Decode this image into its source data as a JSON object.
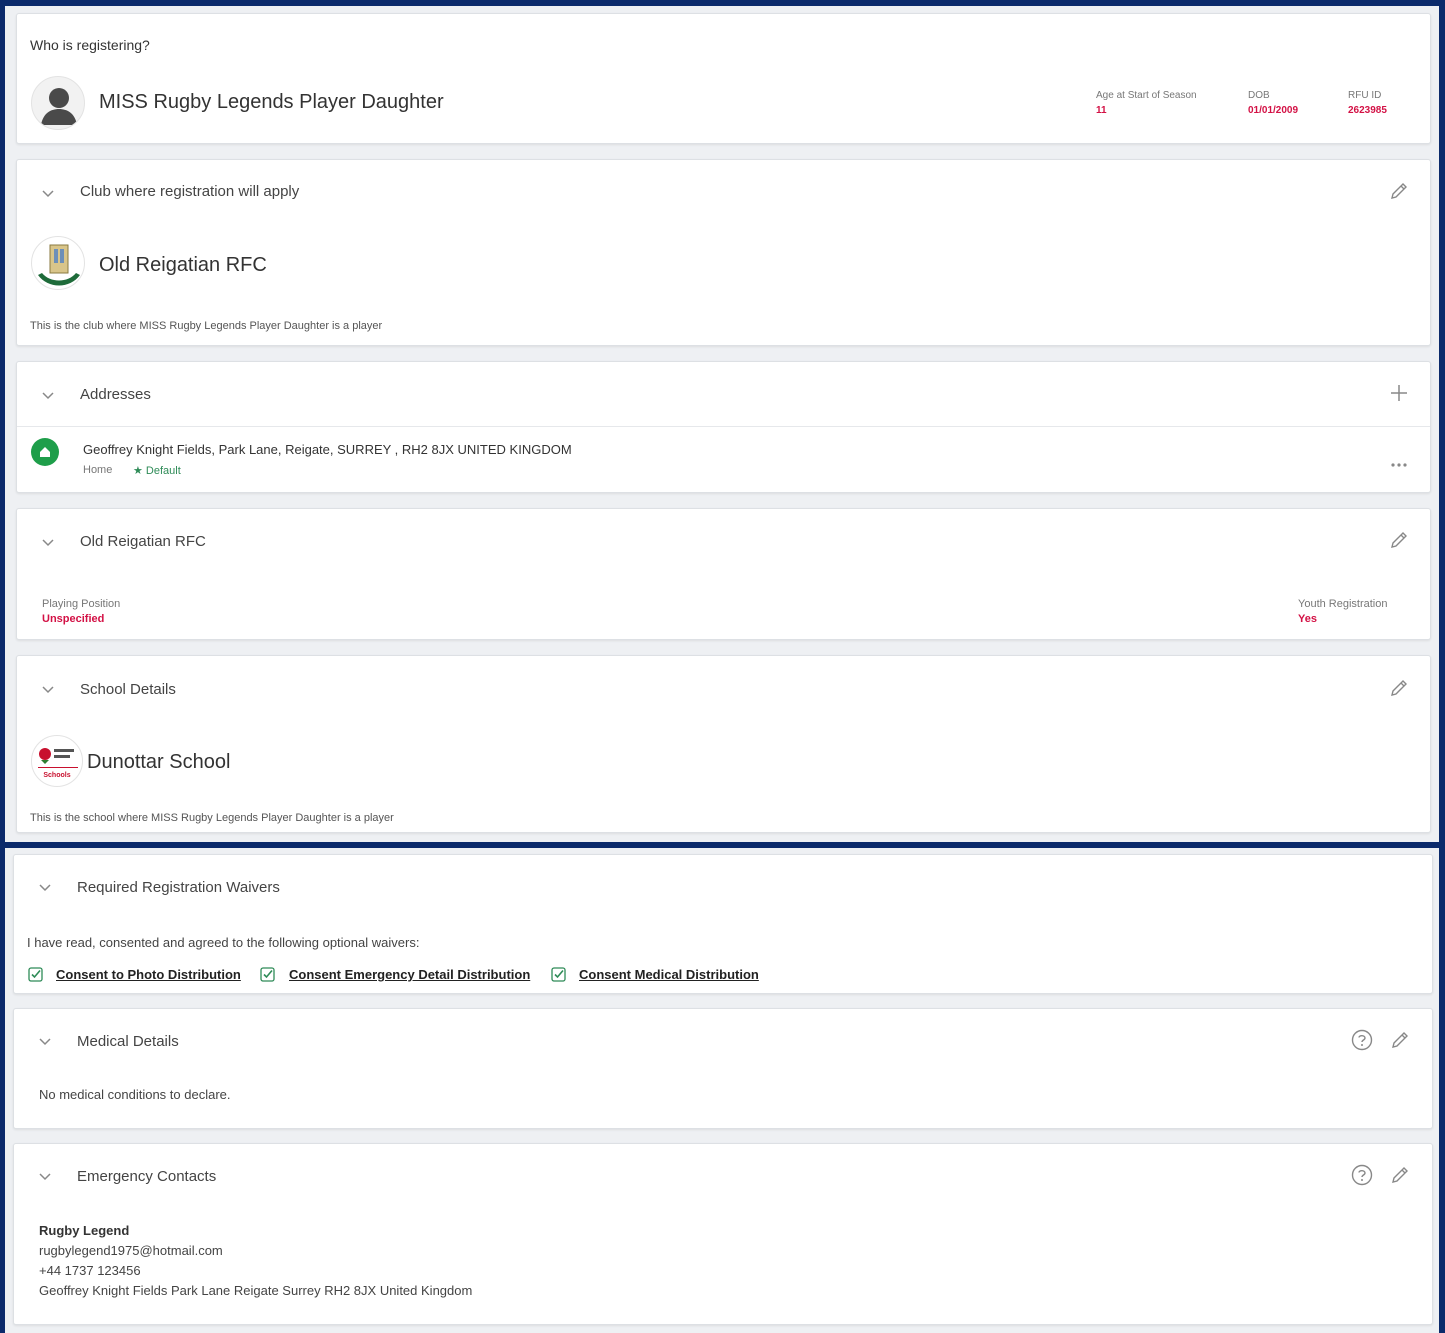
{
  "who": {
    "title": "Who is registering?",
    "name": "MISS Rugby Legends Player Daughter",
    "age_label": "Age at Start of Season",
    "age_value": "11",
    "dob_label": "DOB",
    "dob_value": "01/01/2009",
    "rfu_label": "RFU ID",
    "rfu_value": "2623985"
  },
  "club": {
    "title": "Club where registration will apply",
    "name": "Old Reigatian RFC",
    "note": "This is the club where MISS Rugby Legends Player Daughter is a player"
  },
  "addresses": {
    "title": "Addresses",
    "line": "Geoffrey Knight Fields, Park Lane, Reigate, SURREY , RH2 8JX UNITED KINGDOM",
    "type": "Home",
    "default_label": "★ Default"
  },
  "club_details": {
    "title": "Old Reigatian RFC",
    "position_label": "Playing Position",
    "position_value": "Unspecified",
    "youth_label": "Youth Registration",
    "youth_value": "Yes"
  },
  "school": {
    "title": "School Details",
    "name": "Dunottar School",
    "logo_text": "Schools",
    "note": "This is the school where MISS Rugby Legends Player Daughter is a player"
  },
  "waivers": {
    "title": "Required Registration Waivers",
    "intro": "I have read, consented and agreed to the following optional waivers:",
    "items": [
      "Consent to Photo Distribution",
      "Consent Emergency Detail Distribution",
      "Consent Medical Distribution"
    ]
  },
  "medical": {
    "title": "Medical Details",
    "text": "No medical conditions to declare."
  },
  "emergency": {
    "title": "Emergency Contacts",
    "name": "Rugby Legend",
    "email": "rugbylegend1975@hotmail.com",
    "phone": "+44 1737 123456",
    "address": "Geoffrey Knight Fields Park Lane Reigate Surrey RH2 8JX United Kingdom"
  },
  "colors": {
    "accent_red": "#d31145",
    "check_green": "#2e8b57",
    "home_green": "#1e9e4a",
    "frame_blue": "#0b2a6b"
  }
}
